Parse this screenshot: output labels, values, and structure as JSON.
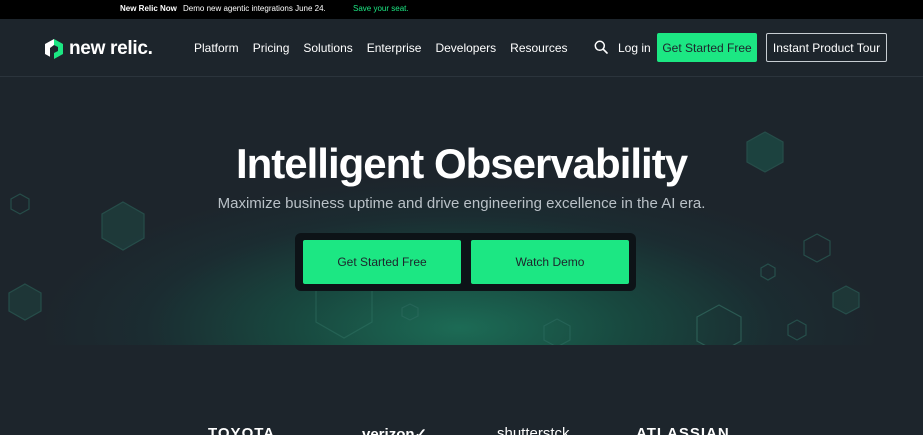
{
  "announcement": {
    "brand": "New Relic Now",
    "text": "Demo new agentic integrations June 24.",
    "link": "Save your seat."
  },
  "nav": {
    "logo_text": "new relic.",
    "links": [
      "Platform",
      "Pricing",
      "Solutions",
      "Enterprise",
      "Developers",
      "Resources"
    ],
    "search_icon": "search-icon",
    "login": "Log in",
    "get_started": "Get Started Free",
    "tour": "Instant Product Tour"
  },
  "hero": {
    "title": "Intelligent Observability",
    "subtitle": "Maximize business uptime and drive engineering excellence in the AI era.",
    "cta_primary": "Get Started Free",
    "cta_secondary": "Watch Demo"
  },
  "customer_logos": [
    "TOYOTA",
    "verizon✓",
    "shutterstсk",
    "ATLASSIAN"
  ],
  "colors": {
    "accent": "#1ce783",
    "background": "#1d252c",
    "announcement_bg": "#000000"
  }
}
